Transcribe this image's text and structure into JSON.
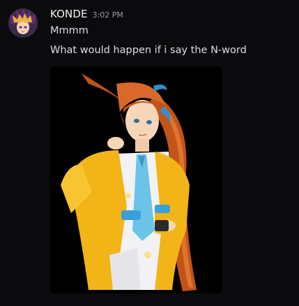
{
  "message": {
    "username": "KONDE",
    "timestamp": "3:02 PM",
    "lines": [
      "Mmmm",
      "What would happen if i say the N-word"
    ]
  },
  "avatar": {
    "icon": "anime-avatar-icon"
  },
  "attachment": {
    "icon": "anime-character-image"
  },
  "colors": {
    "background": "#0b0b0d",
    "username": "#f2f3f5",
    "timestamp": "#949ba4",
    "text": "#dbdee1"
  }
}
